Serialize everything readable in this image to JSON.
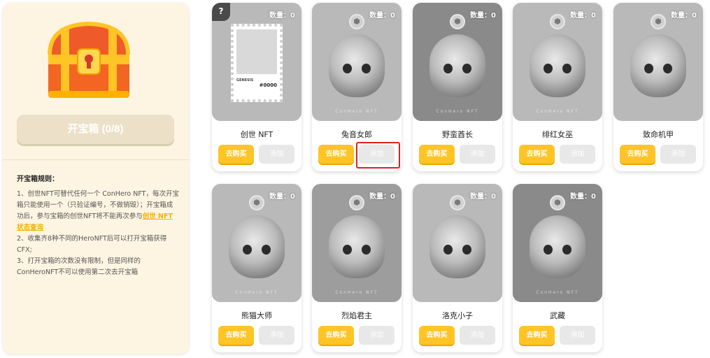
{
  "left": {
    "open_button": "开宝箱 (0/8)",
    "rules_title": "开宝箱规则：",
    "rules": [
      {
        "pre": "1、创世NFT可替代任何一个 ConHero NFT，每次开宝箱只能使用一个（只验证编号，不做销毁）；开宝箱成功后，参与宝箱的创世NFT将不能再次参与",
        "link": "创世 NFT 状态查询"
      },
      {
        "pre": "2、收集齐8种不同的HeroNFT后可以打开宝箱获得CFX;",
        "link": ""
      },
      {
        "pre": "3、打开宝箱的次数没有限制，但是同样的ConHeroNFT不可以使用第二次去开宝箱",
        "link": ""
      }
    ]
  },
  "cards": [
    {
      "name": "创世 NFT",
      "qty": "数量：0",
      "buy": "去购买",
      "add": "添加",
      "badge": "?",
      "stamp_label": "GENESIS",
      "stamp_num": "#0000"
    },
    {
      "name": "兔音女郎",
      "qty": "数量：0",
      "buy": "去购买",
      "add": "添加",
      "watermark": "ConHero NFT"
    },
    {
      "name": "野蛮酋长",
      "qty": "数量：0",
      "buy": "去购买",
      "add": "添加",
      "watermark": "ConHero NFT"
    },
    {
      "name": "绯红女巫",
      "qty": "数量：0",
      "buy": "去购买",
      "add": "添加",
      "watermark": "ConHero NFT"
    },
    {
      "name": "致命机甲",
      "qty": "数量：0",
      "buy": "去购买",
      "add": "添加",
      "watermark": ""
    },
    {
      "name": "熊猫大师",
      "qty": "数量：0",
      "buy": "去购买",
      "add": "添加",
      "watermark": "ConHero NFT"
    },
    {
      "name": "烈焰君主",
      "qty": "数量：0",
      "buy": "去购买",
      "add": "添加",
      "watermark": "ConHero NFT"
    },
    {
      "name": "洛克小子",
      "qty": "数量：0",
      "buy": "去购买",
      "add": "添加",
      "watermark": ""
    },
    {
      "name": "武藏",
      "qty": "数量：0",
      "buy": "去购买",
      "add": "添加",
      "watermark": "ConHero NFT"
    }
  ],
  "colors": {
    "accent": "#ffc425",
    "panel_bg": "#fdf5e2",
    "highlight": "#e02020"
  }
}
